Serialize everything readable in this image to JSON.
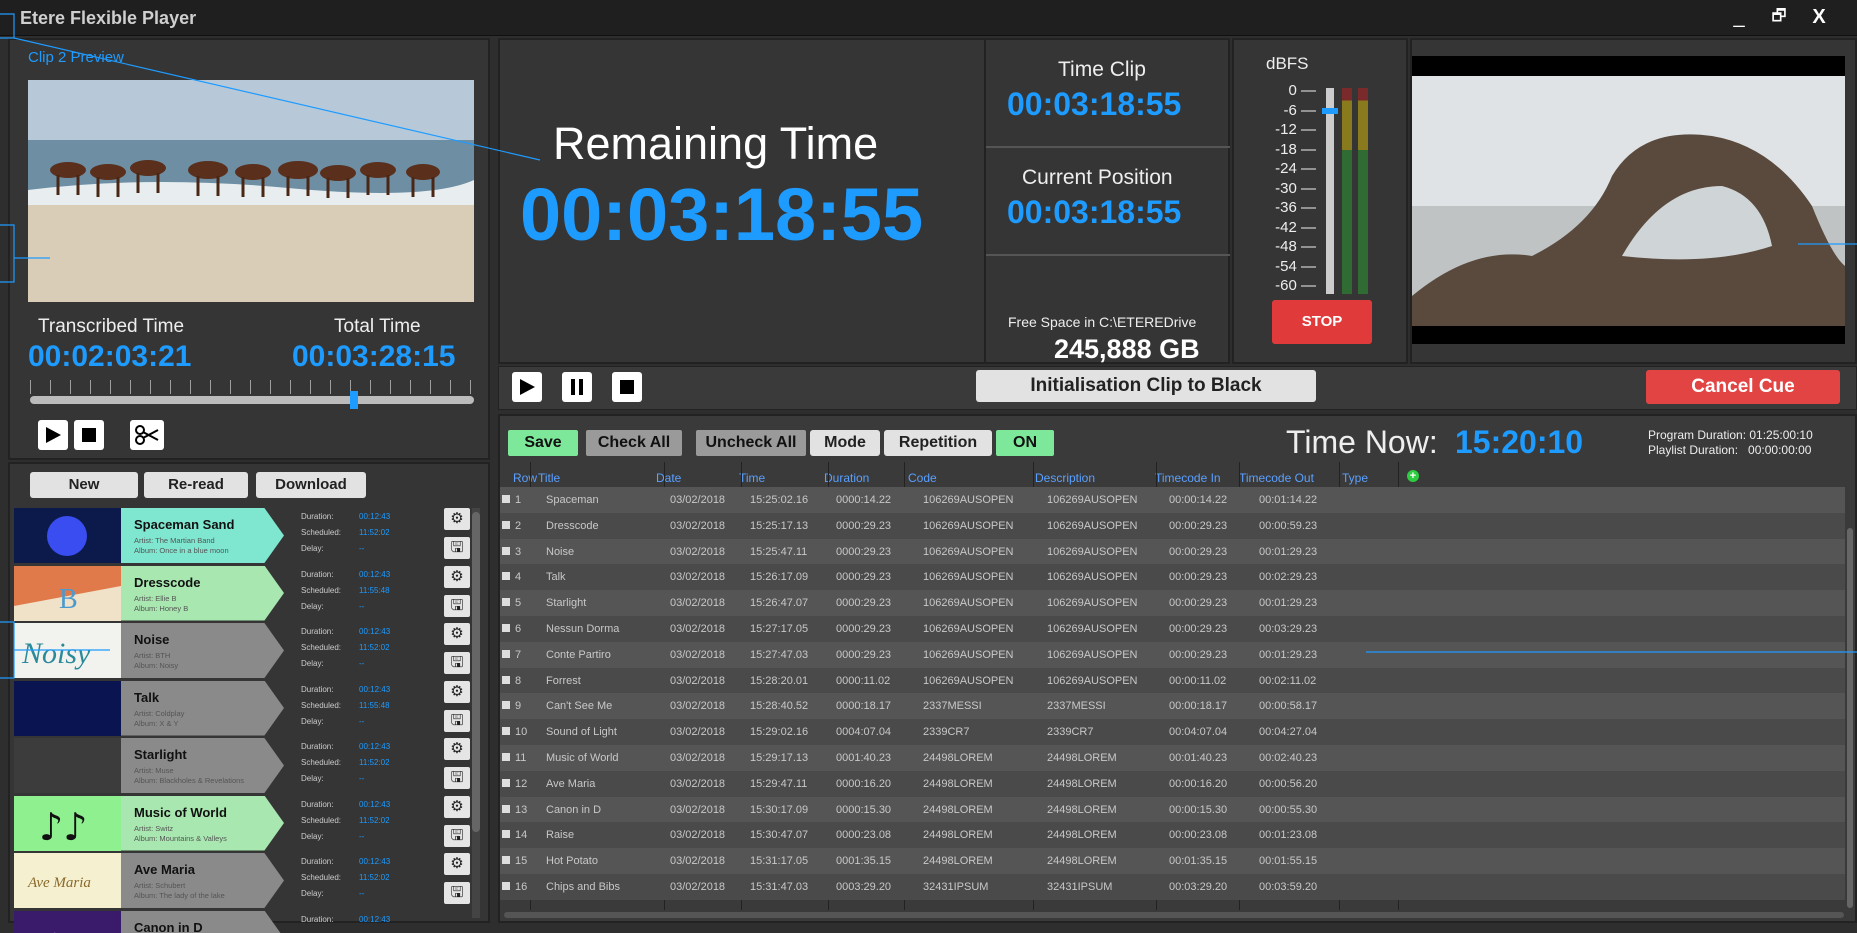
{
  "window": {
    "title": "Etere Flexible Player",
    "minimize": "_",
    "restore": "🗗",
    "close": "X"
  },
  "preview": {
    "label": "Clip 2 Preview",
    "transcribed_label": "Transcribed Time",
    "transcribed_value": "00:02:03:21",
    "total_label": "Total Time",
    "total_value": "00:03:28:15",
    "progress": 0.72
  },
  "remaining": {
    "label": "Remaining Time",
    "value": "00:03:18:55"
  },
  "time_clip": {
    "label": "Time Clip",
    "value": "00:03:18:55"
  },
  "current_position": {
    "label": "Current Position",
    "value": "00:03:18:55"
  },
  "free_space": {
    "label": "Free Space in C:\\ETEREDrive",
    "value": "245,888 GB"
  },
  "meter": {
    "title": "dBFS",
    "scale": [
      "0",
      "-6",
      "-12",
      "-18",
      "-24",
      "-30",
      "-36",
      "-42",
      "-48",
      "-54",
      "-60"
    ],
    "stop_label": "STOP"
  },
  "transport": {
    "init_label": "Initialisation Clip to Black",
    "cancel_label": "Cancel Cue"
  },
  "toolbar": {
    "save": "Save",
    "check_all": "Check All",
    "uncheck_all": "Uncheck All",
    "mode": "Mode",
    "repetition": "Repetition",
    "on": "ON",
    "time_now_label": "Time Now:",
    "time_now_value": "15:20:10",
    "program_duration": "Program Duration: 01:25:00:10",
    "playlist_duration": "Playlist Duration:   00:00:00:00"
  },
  "left_buttons": {
    "new": "New",
    "reread": "Re-read",
    "download": "Download"
  },
  "playlist_labels": {
    "duration": "Duration:",
    "scheduled": "Scheduled:",
    "delay": "Delay:"
  },
  "playlist_items": [
    {
      "name": "Spaceman Sand",
      "artist": "Artist: The Martian Band",
      "album": "Album: Once in a blue moon",
      "duration": "00:12:43",
      "scheduled": "11:52:02",
      "delay": "--",
      "color": "#7fe6d0"
    },
    {
      "name": "Dresscode",
      "artist": "Artist: Ellie B",
      "album": "Album: Honey B",
      "duration": "00:12:43",
      "scheduled": "11:55:48",
      "delay": "--",
      "color": "#a8e8b0"
    },
    {
      "name": "Noise",
      "artist": "Artist: BTH",
      "album": "Album: Noisy",
      "duration": "00:12:43",
      "scheduled": "11:52:02",
      "delay": "--",
      "color": "#8a8a8a",
      "thumb_text": "Noisy"
    },
    {
      "name": "Talk",
      "artist": "Artist: Coldplay",
      "album": "Album: X & Y",
      "duration": "00:12:43",
      "scheduled": "11:55:48",
      "delay": "--",
      "color": "#8a8a8a"
    },
    {
      "name": "Starlight",
      "artist": "Artist: Muse",
      "album": "Album: Blackholes & Revelations",
      "duration": "00:12:43",
      "scheduled": "11:52:02",
      "delay": "--",
      "color": "#8a8a8a"
    },
    {
      "name": "Music of World",
      "artist": "Artist: Switz",
      "album": "Album: Mountains & Valleys",
      "duration": "00:12:43",
      "scheduled": "11:52:02",
      "delay": "--",
      "color": "#a8e8b0"
    },
    {
      "name": "Ave Maria",
      "artist": "Artist: Schubert",
      "album": "Album: The lady of the lake",
      "duration": "00:12:43",
      "scheduled": "11:52:02",
      "delay": "--",
      "color": "#8a8a8a",
      "thumb_text": "Ave Maria"
    },
    {
      "name": "Canon in D",
      "artist": "",
      "album": "",
      "duration": "00:12:43",
      "scheduled": "",
      "delay": "",
      "color": "#8a8a8a"
    }
  ],
  "columns": [
    "Row",
    "Title",
    "Date",
    "Time",
    "Duration",
    "Code",
    "Description",
    "Timecode In",
    "Timecode Out",
    "Type"
  ],
  "rows": [
    [
      "1",
      "Spaceman",
      "03/02/2018",
      "15:25:02.16",
      "0000:14.22",
      "106269AUSOPEN",
      "106269AUSOPEN",
      "00:00:14.22",
      "00:01:14.22"
    ],
    [
      "2",
      "Dresscode",
      "03/02/2018",
      "15:25:17.13",
      "0000:29.23",
      "106269AUSOPEN",
      "106269AUSOPEN",
      "00:00:29.23",
      "00:00:59.23"
    ],
    [
      "3",
      "Noise",
      "03/02/2018",
      "15:25:47.11",
      "0000:29.23",
      "106269AUSOPEN",
      "106269AUSOPEN",
      "00:00:29.23",
      "00:01:29.23"
    ],
    [
      "4",
      "Talk",
      "03/02/2018",
      "15:26:17.09",
      "0000:29.23",
      "106269AUSOPEN",
      "106269AUSOPEN",
      "00:00:29.23",
      "00:02:29.23"
    ],
    [
      "5",
      "Starlight",
      "03/02/2018",
      "15:26:47.07",
      "0000:29.23",
      "106269AUSOPEN",
      "106269AUSOPEN",
      "00:00:29.23",
      "00:01:29.23"
    ],
    [
      "6",
      "Nessun Dorma",
      "03/02/2018",
      "15:27:17.05",
      "0000:29.23",
      "106269AUSOPEN",
      "106269AUSOPEN",
      "00:00:29.23",
      "00:03:29.23"
    ],
    [
      "7",
      "Conte Partiro",
      "03/02/2018",
      "15:27:47.03",
      "0000:29.23",
      "106269AUSOPEN",
      "106269AUSOPEN",
      "00:00:29.23",
      "00:01:29.23"
    ],
    [
      "8",
      "Forrest",
      "03/02/2018",
      "15:28:20.01",
      "0000:11.02",
      "106269AUSOPEN",
      "106269AUSOPEN",
      "00:00:11.02",
      "00:02:11.02"
    ],
    [
      "9",
      "Can't See Me",
      "03/02/2018",
      "15:28:40.52",
      "0000:18.17",
      "2337MESSI",
      "2337MESSI",
      "00:00:18.17",
      "00:00:58.17"
    ],
    [
      "10",
      "Sound of Light",
      "03/02/2018",
      "15:29:02.16",
      "0004:07.04",
      "2339CR7",
      "2339CR7",
      "00:04:07.04",
      "00:04:27.04"
    ],
    [
      "11",
      "Music of World",
      "03/02/2018",
      "15:29:17.13",
      "0001:40.23",
      "24498LOREM",
      "24498LOREM",
      "00:01:40.23",
      "00:02:40.23"
    ],
    [
      "12",
      "Ave Maria",
      "03/02/2018",
      "15:29:47.11",
      "0000:16.20",
      "24498LOREM",
      "24498LOREM",
      "00:00:16.20",
      "00:00:56.20"
    ],
    [
      "13",
      "Canon in D",
      "03/02/2018",
      "15:30:17.09",
      "0000:15.30",
      "24498LOREM",
      "24498LOREM",
      "00:00:15.30",
      "00:00:55.30"
    ],
    [
      "14",
      "Raise",
      "03/02/2018",
      "15:30:47.07",
      "0000:23.08",
      "24498LOREM",
      "24498LOREM",
      "00:00:23.08",
      "00:01:23.08"
    ],
    [
      "15",
      "Hot Potato",
      "03/02/2018",
      "15:31:17.05",
      "0001:35.15",
      "24498LOREM",
      "24498LOREM",
      "00:01:35.15",
      "00:01:55.15"
    ],
    [
      "16",
      "Chips and Bibs",
      "03/02/2018",
      "15:31:47.03",
      "0003:29.20",
      "32431IPSUM",
      "32431IPSUM",
      "00:03:29.20",
      "00:03:59.20"
    ]
  ]
}
